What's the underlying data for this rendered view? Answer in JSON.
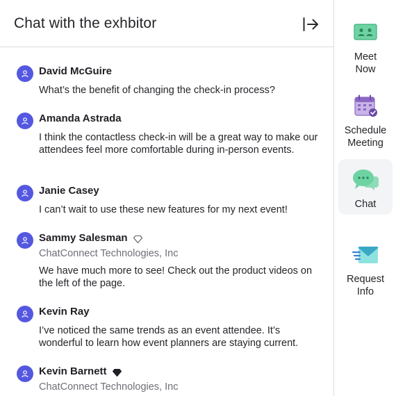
{
  "header": {
    "title": "Chat with the exhbitor"
  },
  "messages": [
    {
      "author": "David McGuire",
      "company": "",
      "badge": "",
      "text": "What’s the benefit of changing the check-in process?"
    },
    {
      "author": "Amanda Astrada",
      "company": "",
      "badge": "",
      "text": "I think the contactless check-in will be a great way to make our attendees feel more comfortable during in-person events."
    },
    {
      "author": "Janie Casey",
      "company": "",
      "badge": "",
      "text": "I can’t wait to use these new features for my next event!"
    },
    {
      "author": "Sammy Salesman",
      "company": "ChatConnect Technologies, Inc",
      "badge": "diamond-outline-icon",
      "text": "We have much more to see! Check out the product videos on the left of the page."
    },
    {
      "author": "Kevin Ray",
      "company": "",
      "badge": "",
      "text": "I’ve noticed the same trends as an event attendee.  It’s wonderful to learn how event planners are staying current."
    },
    {
      "author": "Kevin Barnett",
      "company": "ChatConnect Technologies, Inc",
      "badge": "diamond-filled-icon",
      "text": ""
    }
  ],
  "sidebar": {
    "items": [
      {
        "label_line1": "Meet",
        "label_line2": "Now",
        "icon": "video-meeting-icon",
        "active": false
      },
      {
        "label_line1": "Schedule",
        "label_line2": "Meeting",
        "icon": "calendar-check-icon",
        "active": false
      },
      {
        "label_line1": "Chat",
        "label_line2": "",
        "icon": "chat-bubbles-icon",
        "active": true
      },
      {
        "label_line1": "Request",
        "label_line2": "Info",
        "icon": "envelope-send-icon",
        "active": false
      }
    ]
  },
  "colors": {
    "avatar": "#5458e0",
    "green_accent": "#5fcf9b",
    "purple_accent": "#8c67c4",
    "active_bg": "#f3f4f6"
  }
}
